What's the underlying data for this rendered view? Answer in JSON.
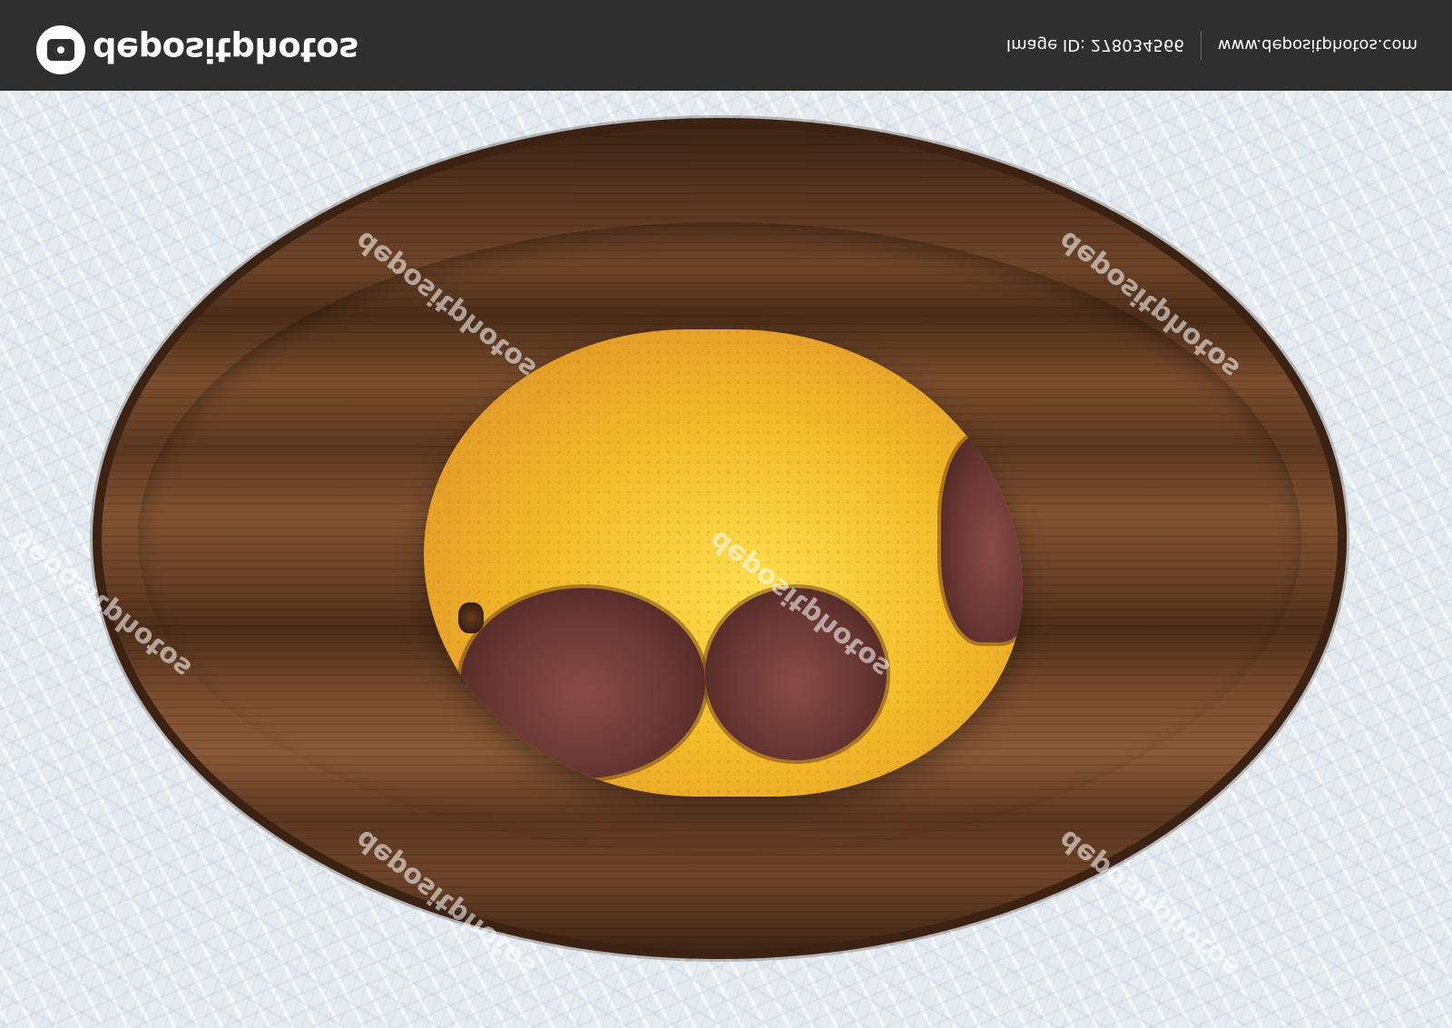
{
  "brand": {
    "name": "depositphotos",
    "image_id": "Image ID: 278034566",
    "site": "www.depositphotos.com"
  },
  "photo": {
    "watermark": "depositphotos"
  },
  "colors": {
    "bar": "#2f2f2f",
    "background": "#e6ebf0",
    "board": "#6d4428",
    "pear": "#e9b52a",
    "bruise": "#6a3834"
  }
}
